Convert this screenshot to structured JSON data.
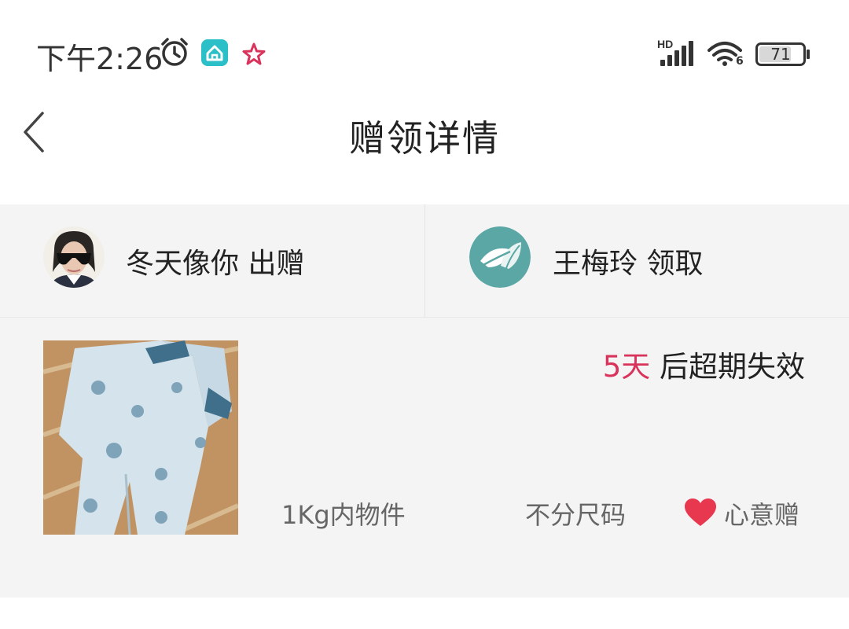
{
  "status_bar": {
    "time": "下午2:26",
    "network": "HD",
    "wifi_sub": "6",
    "battery": "71",
    "icons": [
      "alarm-icon",
      "home-app-icon",
      "star-icon",
      "signal-icon",
      "wifi-icon",
      "battery-icon"
    ]
  },
  "header": {
    "title": "赠领详情",
    "back_icon": "chevron-left-icon"
  },
  "parties": {
    "giver": {
      "label": "冬天像你 出赠"
    },
    "receiver": {
      "label": "王梅玲 领取"
    }
  },
  "item": {
    "expire_days": "5天",
    "expire_suffix": " 后超期失效",
    "weight": "1Kg内物件",
    "size": "不分尺码",
    "gift_type": "心意赠"
  },
  "colors": {
    "accent_red": "#d9335b",
    "heart": "#e8384f",
    "teal": "#5aa7a5",
    "card_bg": "#f4f4f4"
  }
}
